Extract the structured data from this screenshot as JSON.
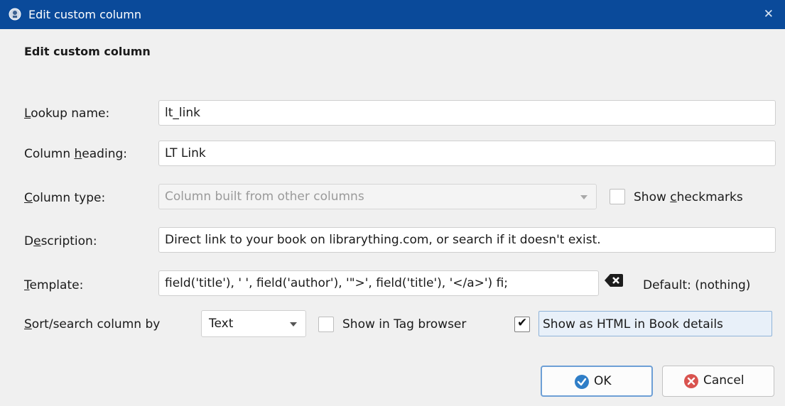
{
  "window": {
    "title": "Edit custom column",
    "close_glyph": "✕"
  },
  "form": {
    "heading": "Edit custom column",
    "lookup_name": {
      "pre": "",
      "key": "L",
      "post": "ookup name:",
      "value": "lt_link"
    },
    "column_heading": {
      "pre": "Column ",
      "key": "h",
      "post": "eading:",
      "value": "LT Link"
    },
    "column_type": {
      "pre": "",
      "key": "C",
      "post": "olumn type:",
      "value": "Column built from other columns"
    },
    "show_checkmarks": {
      "pre": "Show ",
      "key": "c",
      "post": "heckmarks",
      "checked": false
    },
    "description": {
      "pre": "D",
      "key": "e",
      "post": "scription:",
      "value": "Direct link to your book on librarything.com, or search if it doesn't exist."
    },
    "template": {
      "pre": "",
      "key": "T",
      "post": "emplate:",
      "value": "field('title'), ' ', field('author'), '\">', field('title'), '</a>')     fi;",
      "default_text": "Default: (nothing)"
    },
    "sort_search": {
      "pre": "",
      "key": "S",
      "post": "ort/search column by",
      "value": "Text"
    },
    "show_in_tag_browser": {
      "label": "Show in Tag browser",
      "checked": false
    },
    "show_as_html": {
      "label": "Show as HTML in Book details",
      "checked": true
    }
  },
  "buttons": {
    "ok": "OK",
    "cancel": "Cancel"
  },
  "icons": {
    "app": "calibre-app-icon",
    "clear": "backspace-clear-icon",
    "ok": "check-circle-icon",
    "cancel": "x-circle-icon"
  },
  "colors": {
    "titlebar": "#0a4a9a",
    "accent": "#2f7ec7",
    "cancel": "#d9534f"
  }
}
